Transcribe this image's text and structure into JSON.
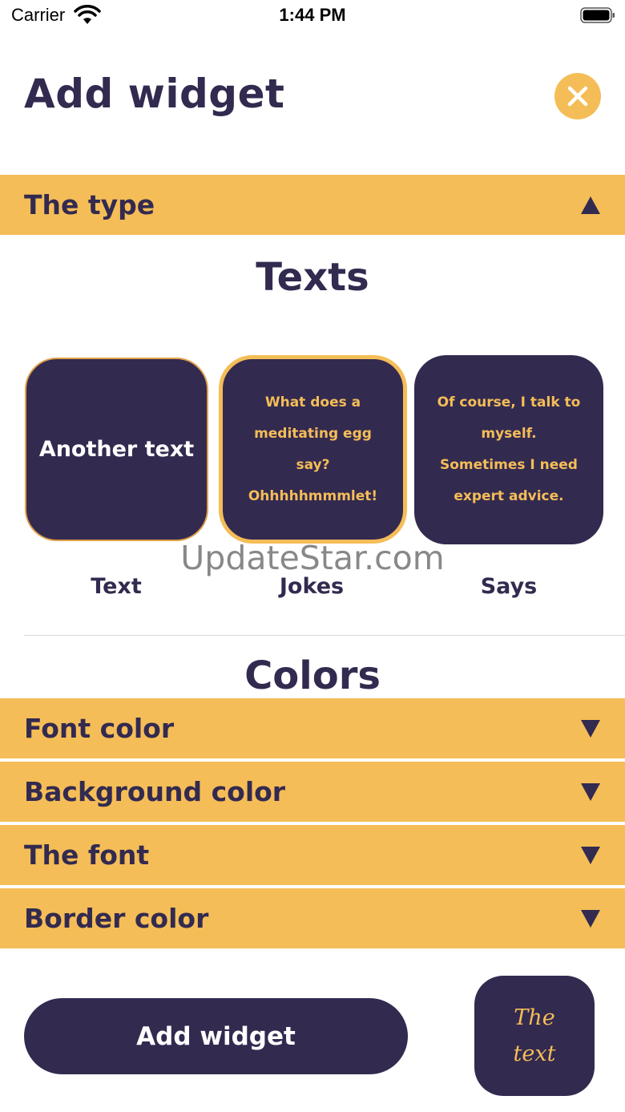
{
  "status_bar": {
    "carrier": "Carrier",
    "time": "1:44 PM"
  },
  "header": {
    "title": "Add widget"
  },
  "type_section": {
    "label": "The type",
    "title": "Texts"
  },
  "cards": [
    {
      "preview_text": "Another text",
      "caption": "Text"
    },
    {
      "preview_text": "What does a\nmeditating egg\nsay?\nOhhhhhmmmlet!",
      "caption": "Jokes"
    },
    {
      "preview_text": "Of course, I talk to\nmyself.\nSometimes I need\nexpert advice.",
      "caption": "Says"
    }
  ],
  "watermark": "UpdateStar.com",
  "colors_section": {
    "title": "Colors"
  },
  "dropdowns": [
    {
      "label": "Font color"
    },
    {
      "label": "Background color"
    },
    {
      "label": "The font"
    },
    {
      "label": "Border color"
    }
  ],
  "footer": {
    "add_button": "Add widget",
    "preview_text": "The\ntext"
  },
  "colors": {
    "accent": "#f4bd57",
    "primary": "#332a50",
    "background": "#ffffff"
  }
}
